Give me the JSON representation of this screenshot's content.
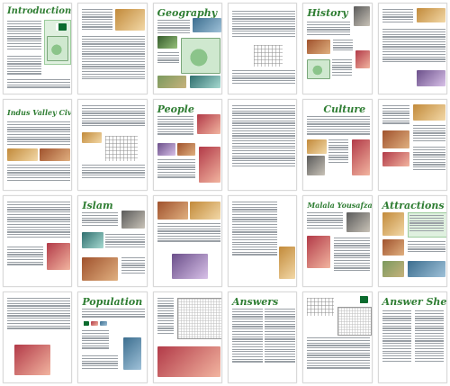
{
  "titles": {
    "introduction": "Introduction",
    "geography": "Geography",
    "history": "History",
    "indus": "Indus Valley Civilisation",
    "people": "People",
    "culture": "Culture",
    "islam": "Islam",
    "malala": "Malala Yousafzai",
    "attractions": "Attractions",
    "population": "Population",
    "answers": "Answers",
    "answer_sheet": "Answer Sheet"
  },
  "colors": {
    "accent": "#2e7d32",
    "page_border": "#d9d9d9",
    "text_line": "#9aa0a6"
  }
}
